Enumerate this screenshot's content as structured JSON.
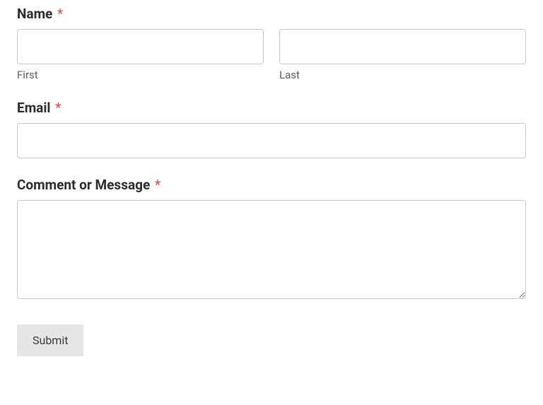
{
  "form": {
    "name": {
      "label": "Name",
      "required": "*",
      "first": {
        "value": "",
        "sublabel": "First"
      },
      "last": {
        "value": "",
        "sublabel": "Last"
      }
    },
    "email": {
      "label": "Email",
      "required": "*",
      "value": ""
    },
    "message": {
      "label": "Comment or Message",
      "required": "*",
      "value": ""
    },
    "submit": {
      "label": "Submit"
    }
  }
}
